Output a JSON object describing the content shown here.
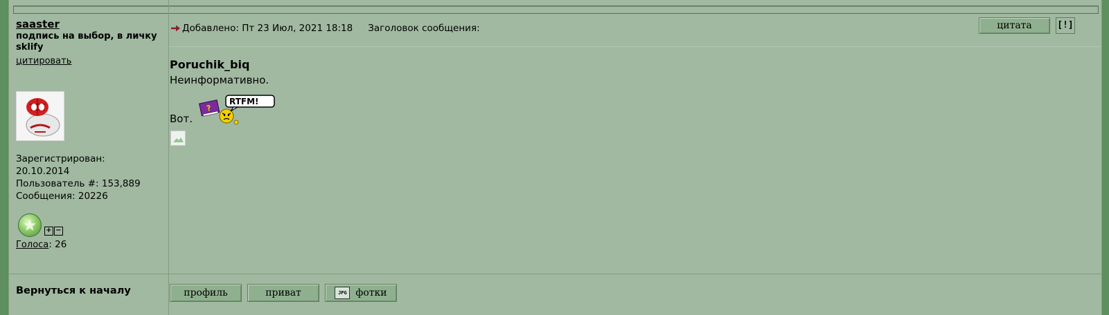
{
  "author": {
    "username": "saaster",
    "signature": "подпись на выбор, в личку sklify",
    "quote_link": "цитировать",
    "registered_label": "Зарегистрирован:",
    "registered_date": "20.10.2014",
    "user_number": "Пользователь #: 153,889",
    "messages": "Сообщения: 20226",
    "votes_label": "Голоса",
    "votes_value": ": 26"
  },
  "post": {
    "added": "Добавлено: Пт 23 Июл, 2021 18:18",
    "subject_label": "Заголовок сообщения:",
    "quote_author": "Poruchik_biq",
    "line1": "Неинформативно.",
    "smiley_text": "RTFM!",
    "line2": "Вот."
  },
  "buttons": {
    "quote": "цитата",
    "report": "[!]",
    "profile": "профиль",
    "private": "приват",
    "photos": "фотки",
    "jpg_icon": "JPG"
  },
  "footer": {
    "back_to_top": "Вернуться к началу"
  },
  "colors": {
    "background": "#a1b9a1",
    "outer": "#5e8f5e",
    "button": "#8fb08f"
  }
}
